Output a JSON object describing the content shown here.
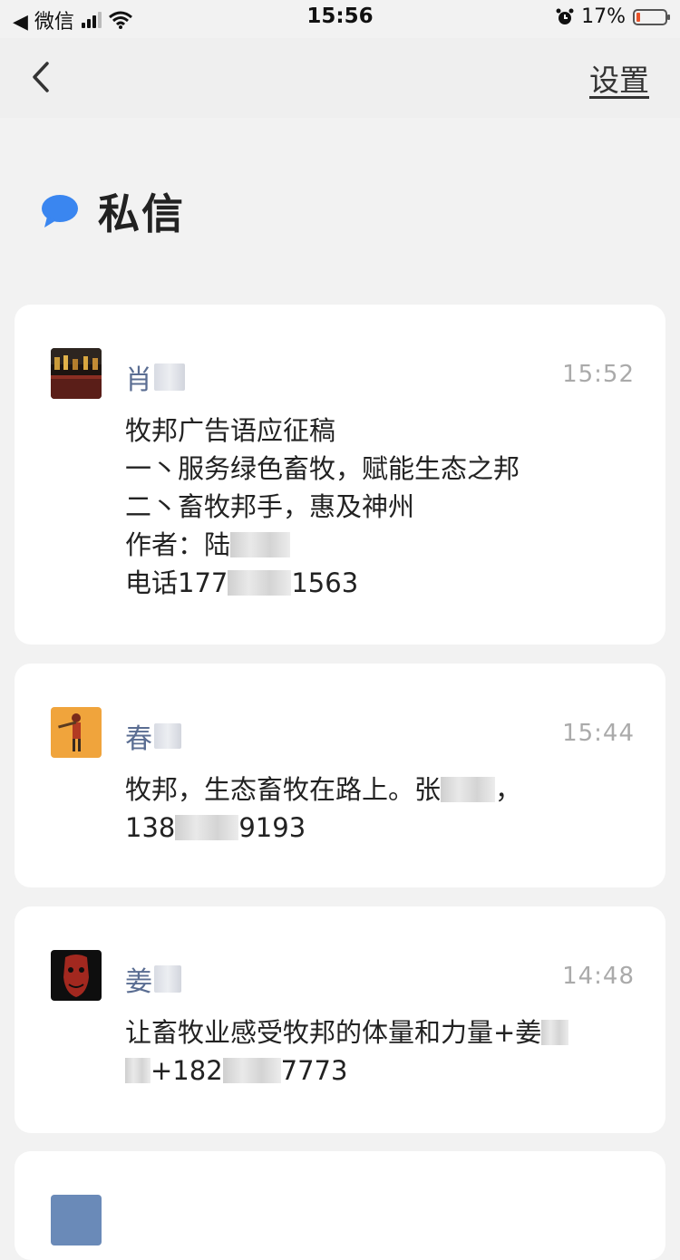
{
  "status_bar": {
    "back_app": "◀ 微信",
    "time": "15:56",
    "battery": "17%"
  },
  "nav": {
    "settings_label": "设置"
  },
  "section": {
    "title": "私信"
  },
  "messages": [
    {
      "sender": "肖",
      "time": "15:52",
      "lines": [
        "牧邦广告语应征稿",
        "一丶服务绿色畜牧，赋能生态之邦",
        "二丶畜牧邦手，惠及神州",
        "作者：陆",
        "电话177",
        "1563"
      ]
    },
    {
      "sender": "春",
      "time": "15:44",
      "lines": [
        "牧邦，生态畜牧在路上。张",
        "，",
        "138",
        "9193"
      ]
    },
    {
      "sender": "姜",
      "time": "14:48",
      "lines": [
        "让畜牧业感受牧邦的体量和力量+姜",
        "+182",
        "7773"
      ]
    }
  ],
  "colors": {
    "background": "#f2f2f2",
    "card": "#ffffff",
    "sender_name": "#5a6d92",
    "timestamp": "#aaaaaa",
    "chat_icon": "#3a86f0"
  },
  "icons": [
    "back-arrow-icon",
    "chat-bubble-icon",
    "wifi-icon",
    "signal-icon",
    "alarm-icon",
    "battery-icon"
  ]
}
